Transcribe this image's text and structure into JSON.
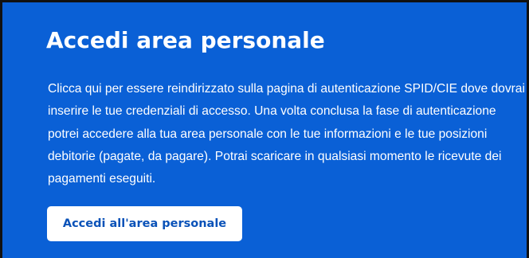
{
  "card": {
    "title": "Accedi area personale",
    "description": "Clicca qui per essere reindirizzato sulla pagina di autenticazione SPID/CIE dove dovrai inserire le tue credenziali di accesso. Una volta conclusa la fase di autenticazione potrei accedere alla tua area personale con le tue informazioni e le tue posizioni debitorie (pagate, da pagare). Potrai scaricare in qualsiasi momento le ricevute dei pagamenti eseguiti.",
    "button_label": "Accedi all'area personale"
  },
  "colors": {
    "background": "#0a60d6",
    "text": "#ffffff",
    "button_background": "#ffffff",
    "button_text": "#0a52b8",
    "border": "#111111"
  }
}
